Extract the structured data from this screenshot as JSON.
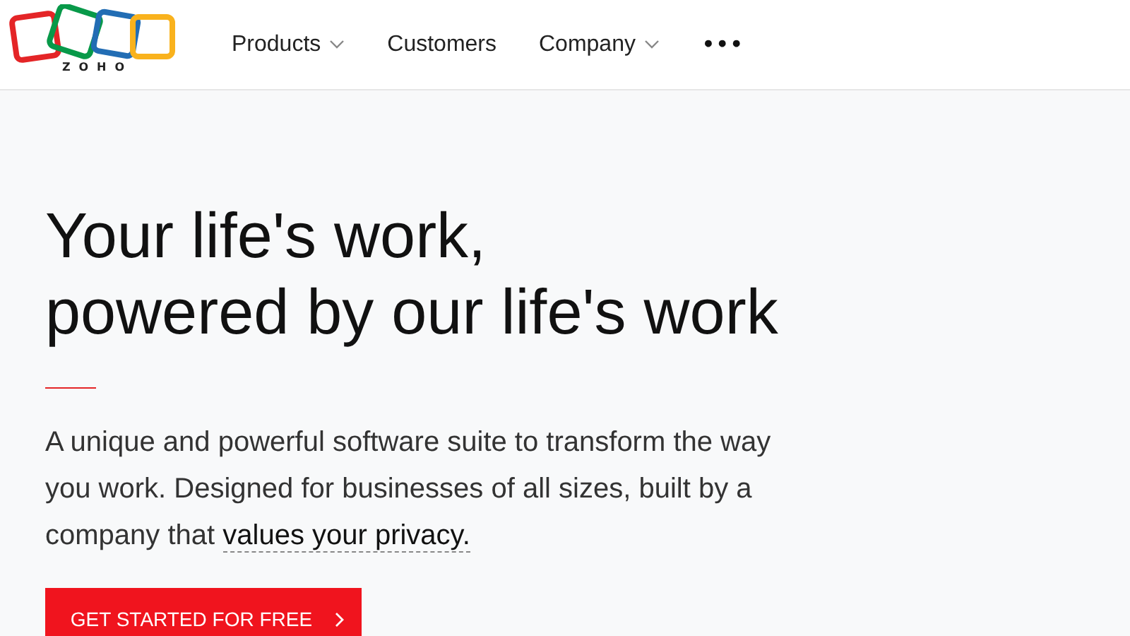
{
  "header": {
    "logo_text": "ZOHO",
    "nav": [
      {
        "label": "Products",
        "dropdown": true
      },
      {
        "label": "Customers",
        "dropdown": false
      },
      {
        "label": "Company",
        "dropdown": true
      }
    ],
    "more": "•••"
  },
  "hero": {
    "headline": [
      "Your life's work,",
      "powered by our life's work"
    ],
    "intro": {
      "text": "A unique and powerful software suite to transform the way you work. Designed for businesses of all sizes, built by a company that ",
      "link": "values your privacy."
    },
    "button": "GET STARTED FOR FREE"
  }
}
